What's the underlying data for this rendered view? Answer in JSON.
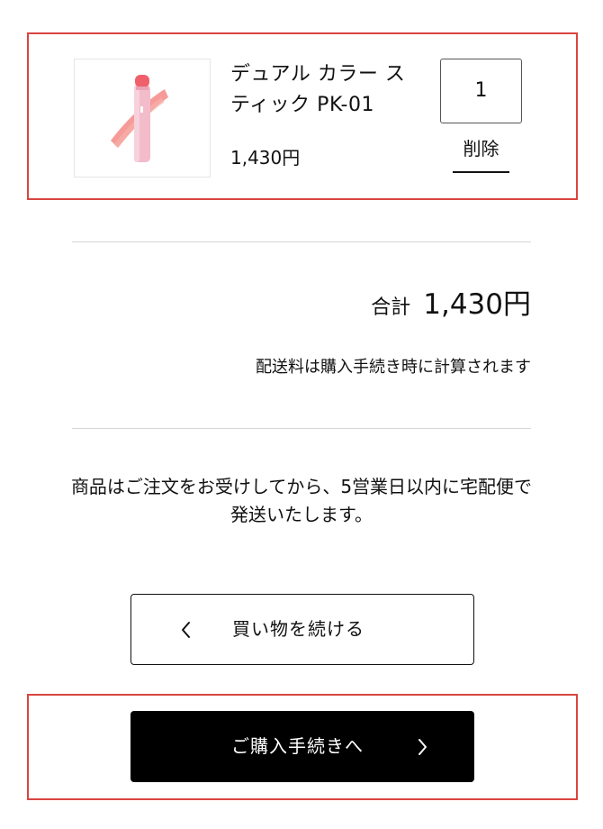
{
  "cart_item": {
    "image_icon": "product-lip-stick-image",
    "name": "デュアル カラー スティック PK-01",
    "price": "1,430円",
    "quantity": "1",
    "delete_label": "削除"
  },
  "summary": {
    "total_label": "合計",
    "total_value": "1,430円",
    "shipping_note": "配送料は購入手続き時に計算されます"
  },
  "delivery_note": "商品はご注文をお受けしてから、5営業日以内に宅配便で発送いたします。",
  "buttons": {
    "continue_label": "買い物を続ける",
    "continue_icon": "chevron-left-icon",
    "checkout_label": "ご購入手続きへ",
    "checkout_icon": "chevron-right-icon"
  },
  "colors": {
    "highlight": "#d9453f",
    "checkout_bg": "#000000",
    "divider": "#d6d6d6",
    "product_pink": "#f2b6c3",
    "product_swatch": "#f48a86"
  }
}
